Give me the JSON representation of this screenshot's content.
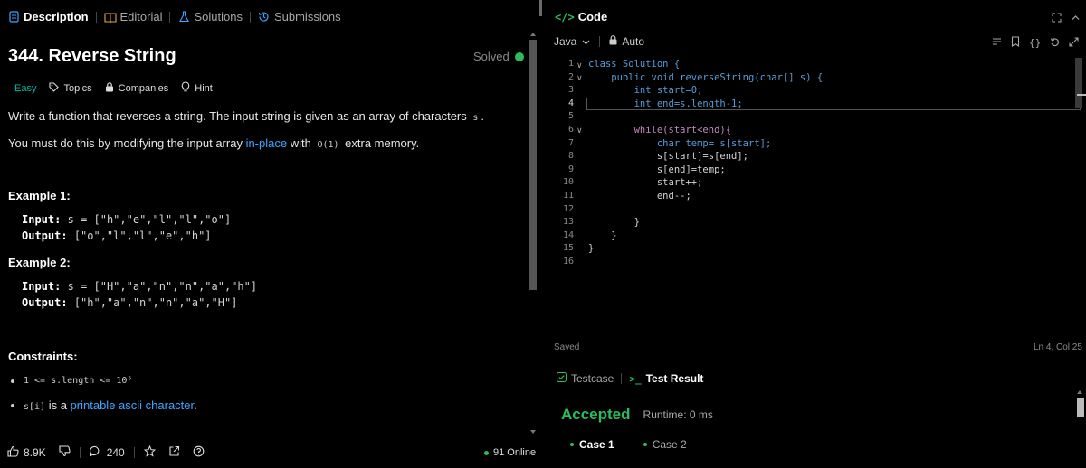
{
  "left_tabs": [
    {
      "label": "Description",
      "icon": "document-icon",
      "active": true
    },
    {
      "label": "Editorial",
      "icon": "book-icon",
      "active": false
    },
    {
      "label": "Solutions",
      "icon": "flask-icon",
      "active": false
    },
    {
      "label": "Submissions",
      "icon": "history-icon",
      "active": false
    }
  ],
  "problem": {
    "title": "344. Reverse String",
    "status": "Solved",
    "difficulty": "Easy",
    "topics_label": "Topics",
    "companies_label": "Companies",
    "hint_label": "Hint",
    "desc1": "Write a function that reverses a string. The input string is given as an array of characters ",
    "desc1_code": "s",
    "desc1_end": ".",
    "desc2_a": "You must do this by modifying the input array ",
    "desc2_link": "in-place",
    "desc2_b": " with ",
    "desc2_code": "O(1)",
    "desc2_c": " extra memory.",
    "examples": [
      {
        "title": "Example 1:",
        "input_label": "Input:",
        "input": "s = [\"h\",\"e\",\"l\",\"l\",\"o\"]",
        "output_label": "Output:",
        "output": "[\"o\",\"l\",\"l\",\"e\",\"h\"]"
      },
      {
        "title": "Example 2:",
        "input_label": "Input:",
        "input": "s = [\"H\",\"a\",\"n\",\"n\",\"a\",\"h\"]",
        "output_label": "Output:",
        "output": "[\"h\",\"a\",\"n\",\"n\",\"a\",\"H\"]"
      }
    ],
    "constraints_title": "Constraints:",
    "constraint1": "1 <= s.length <= 10⁵",
    "constraint2_code": "s[i]",
    "constraint2_a": " is a ",
    "constraint2_link": "printable ascii character",
    "constraint2_b": "."
  },
  "footer": {
    "likes": "8.9K",
    "comments": "240",
    "online": "91 Online"
  },
  "editor": {
    "title": "Code",
    "language": "Java",
    "mode": "Auto",
    "saved": "Saved",
    "cursor": "Ln 4, Col 25",
    "line_numbers": [
      "1",
      "2",
      "3",
      "4",
      "5",
      "6",
      "7",
      "8",
      "9",
      "10",
      "11",
      "12",
      "13",
      "14",
      "15",
      "16"
    ],
    "code": [
      "class Solution {",
      "    public void reverseString(char[] s) {",
      "        int start=0;",
      "        int end=s.length-1;",
      "",
      "        while(start<end){",
      "            char temp= s[start];",
      "            s[start]=s[end];",
      "            s[end]=temp;",
      "            start++;",
      "            end--;",
      "",
      "        }",
      "    }",
      "}",
      ""
    ]
  },
  "result": {
    "testcase_tab": "Testcase",
    "result_tab": "Test Result",
    "status": "Accepted",
    "runtime": "Runtime: 0 ms",
    "cases": [
      "Case 1",
      "Case 2"
    ]
  },
  "colors": {
    "accent_green": "#2cbb5d",
    "link_blue": "#3ea6ff",
    "easy": "#00b8a3"
  }
}
